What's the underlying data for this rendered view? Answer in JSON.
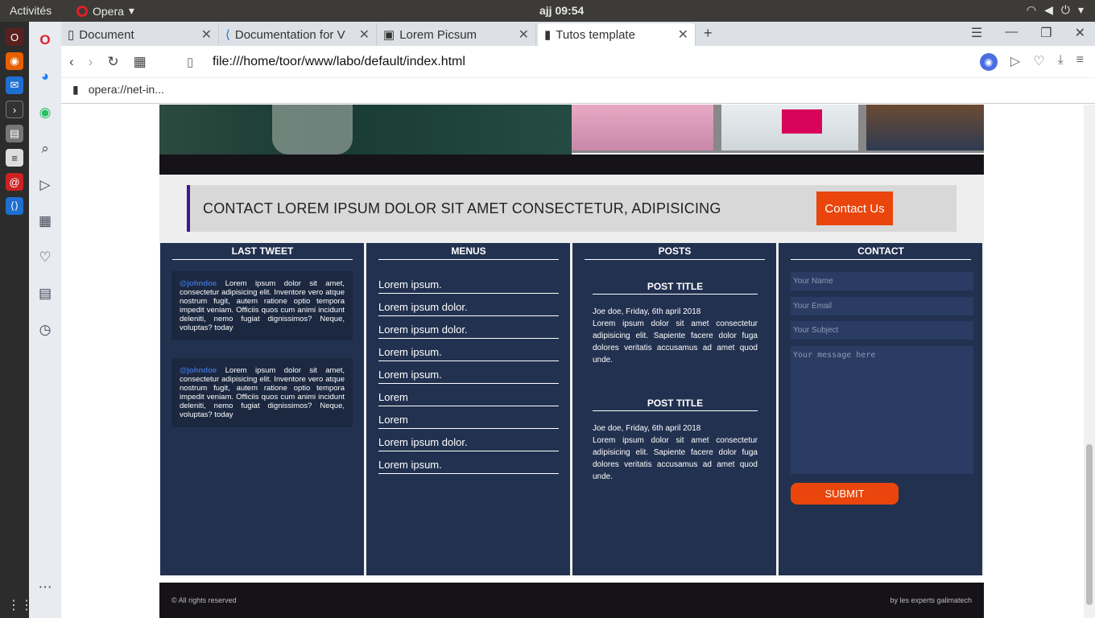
{
  "os": {
    "activities": "Activités",
    "app": "Opera",
    "clock": "ajj 09:54"
  },
  "browser": {
    "tabs": [
      {
        "label": "Document",
        "icon": "document-icon"
      },
      {
        "label": "Documentation for V",
        "icon": "vscode-icon"
      },
      {
        "label": "Lorem Picsum",
        "icon": "image-icon"
      },
      {
        "label": "Tutos template",
        "icon": "document-icon"
      }
    ],
    "url": "file:///home/toor/www/labo/default/index.html",
    "bookmark": "opera://net-in..."
  },
  "page": {
    "contact_banner": {
      "text": "CONTACT LOREM IPSUM DOLOR SIT AMET CONSECTETUR, ADIPISICING",
      "button": "Contact Us"
    },
    "columns": {
      "tweet": {
        "title": "LAST TWEET",
        "handle": "@johndoe",
        "text": "Lorem ipsum dolor sit amet, consectetur adipisicing elit. Inventore vero atque nostrum fugit, autem ratione optio tempora impedit veniam. Officiis quos cum animi incidunt deleniti, nemo fugiat dignissimos? Neque, voluptas? today"
      },
      "menus": {
        "title": "MENUS",
        "items": [
          "Lorem ipsum.",
          "Lorem ipsum dolor.",
          "Lorem ipsum dolor.",
          "Lorem ipsum.",
          "Lorem ipsum.",
          "Lorem",
          "Lorem",
          "Lorem ipsum dolor.",
          "Lorem ipsum."
        ]
      },
      "posts": {
        "title": "POSTS",
        "post_title": "POST TITLE",
        "meta": "Joe doe, Friday, 6th april 2018",
        "body": "Lorem ipsum dolor sit amet consectetur adipisicing elit. Sapiente facere dolor fuga dolores veritatis accusamus ad amet quod unde."
      },
      "contact": {
        "title": "CONTACT",
        "name": "Your Name",
        "email": "Your Email",
        "subject": "Your Subject",
        "message": "Your message here",
        "submit": "SUBMIT"
      }
    },
    "footer": {
      "left": "© All rights reserved",
      "right": "by les experts galimatech"
    }
  },
  "colors": {
    "accent": "#e9450c",
    "dark_blue": "#22314f",
    "border_purple": "#3c1a8a"
  }
}
